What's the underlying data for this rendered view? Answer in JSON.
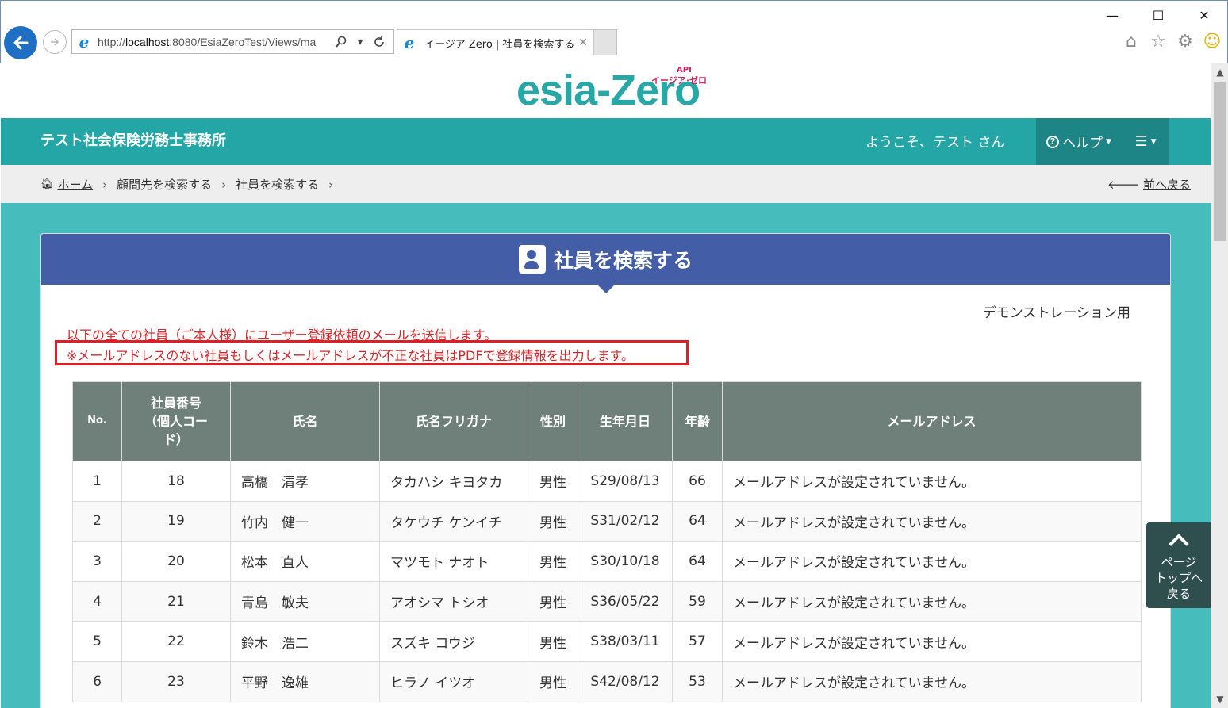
{
  "browser": {
    "url_prefix": "http://",
    "url_host": "localhost",
    "url_rest": ":8080/EsiaZeroTest/Views/ma",
    "tab_title": "イージア Zero | 社員を検索する",
    "window_controls": [
      "—",
      "☐",
      "✕"
    ]
  },
  "logo": {
    "main": "esia-Zero",
    "sub": "イージア·ゼロ",
    "badge": "API"
  },
  "header": {
    "office_name": "テスト社会保険労務士事務所",
    "welcome": "ようこそ、テスト さん",
    "help_label": "ヘルプ"
  },
  "breadcrumb": {
    "home": "ホーム",
    "item1": "顧問先を検索する",
    "item2": "社員を検索する",
    "back": "前へ戻る"
  },
  "panel": {
    "title": "社員を検索する",
    "demo_label": "デモンストレーション用",
    "notice_1": "以下の全ての社員（ご本人様）にユーザー登録依頼のメールを送信します。",
    "notice_2": "※メールアドレスのない社員もしくはメールアドレスが不正な社員はPDFで登録情報を出力します。"
  },
  "table": {
    "headers": {
      "no": "No.",
      "emp_no_1": "社員番号",
      "emp_no_2": "（個人コー",
      "emp_no_3": "ド）",
      "name": "氏名",
      "kana": "氏名フリガナ",
      "gender": "性別",
      "birth": "生年月日",
      "age": "年齢",
      "email": "メールアドレス"
    },
    "rows": [
      {
        "no": "1",
        "emp": "18",
        "name": "高橋　清孝",
        "kana": "タカハシ キヨタカ",
        "gender": "男性",
        "birth": "S29/08/13",
        "age": "66",
        "email": "メールアドレスが設定されていません。"
      },
      {
        "no": "2",
        "emp": "19",
        "name": "竹内　健一",
        "kana": "タケウチ ケンイチ",
        "gender": "男性",
        "birth": "S31/02/12",
        "age": "64",
        "email": "メールアドレスが設定されていません。"
      },
      {
        "no": "3",
        "emp": "20",
        "name": "松本　直人",
        "kana": "マツモト ナオト",
        "gender": "男性",
        "birth": "S30/10/18",
        "age": "64",
        "email": "メールアドレスが設定されていません。"
      },
      {
        "no": "4",
        "emp": "21",
        "name": "青島　敏夫",
        "kana": "アオシマ トシオ",
        "gender": "男性",
        "birth": "S36/05/22",
        "age": "59",
        "email": "メールアドレスが設定されていません。"
      },
      {
        "no": "5",
        "emp": "22",
        "name": "鈴木　浩二",
        "kana": "スズキ コウジ",
        "gender": "男性",
        "birth": "S38/03/11",
        "age": "57",
        "email": "メールアドレスが設定されていません。"
      },
      {
        "no": "6",
        "emp": "23",
        "name": "平野　逸雄",
        "kana": "ヒラノ イツオ",
        "gender": "男性",
        "birth": "S42/08/12",
        "age": "53",
        "email": "メールアドレスが設定されていません。"
      }
    ]
  },
  "page_top": {
    "line1": "ページ",
    "line2": "トップへ",
    "line3": "戻る"
  }
}
